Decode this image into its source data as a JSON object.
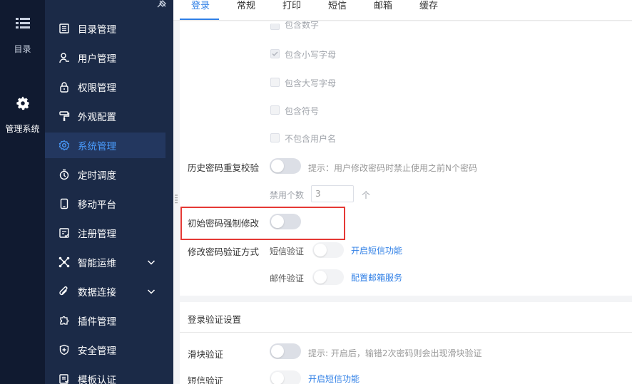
{
  "rail": {
    "catalog_label": "目录",
    "system_label": "管理系统"
  },
  "sidebar": {
    "items": [
      {
        "label": "目录管理",
        "icon": "list-icon"
      },
      {
        "label": "用户管理",
        "icon": "user-icon"
      },
      {
        "label": "权限管理",
        "icon": "lock-icon"
      },
      {
        "label": "外观配置",
        "icon": "paint-roller-icon"
      },
      {
        "label": "系统管理",
        "icon": "gear-icon",
        "active": true
      },
      {
        "label": "定时调度",
        "icon": "timer-icon"
      },
      {
        "label": "移动平台",
        "icon": "mobile-icon"
      },
      {
        "label": "注册管理",
        "icon": "register-icon"
      },
      {
        "label": "智能运维",
        "icon": "network-icon",
        "expandable": true
      },
      {
        "label": "数据连接",
        "icon": "paperclip-icon",
        "expandable": true
      },
      {
        "label": "插件管理",
        "icon": "puzzle-icon"
      },
      {
        "label": "安全管理",
        "icon": "shield-icon"
      },
      {
        "label": "模板认证",
        "icon": "template-icon"
      }
    ]
  },
  "tabs": [
    "登录",
    "常规",
    "打印",
    "短信",
    "邮箱",
    "缓存"
  ],
  "password_rules": {
    "cut_off_label": "包含数字",
    "lowercase_label": "包含小写字母",
    "uppercase_label": "包含大写字母",
    "symbols_label": "包含符号",
    "no_username_label": "不包含用户名"
  },
  "history_check": {
    "label": "历史密码重复校验",
    "hint": "提示：用户修改密码时禁止使用之前N个密码",
    "disabled_count_label": "禁用个数",
    "disabled_count_value": "3",
    "unit": "个"
  },
  "initial_password": {
    "label": "初始密码强制修改"
  },
  "modify_verify": {
    "label": "修改密码验证方式",
    "sms_label": "短信验证",
    "sms_link": "开启短信功能",
    "email_label": "邮件验证",
    "email_link": "配置邮箱服务"
  },
  "login_verify": {
    "section_title": "登录验证设置",
    "slider_label": "滑块验证",
    "slider_hint": "提示: 开启后，输错2次密码则会出现滑块验证",
    "sms_label": "短信验证",
    "sms_link": "开启短信功能"
  },
  "colors": {
    "accent": "#2f7fe6",
    "highlight": "#e53935",
    "sidebar_bg": "#1b2a47",
    "rail_bg": "#101a30"
  }
}
